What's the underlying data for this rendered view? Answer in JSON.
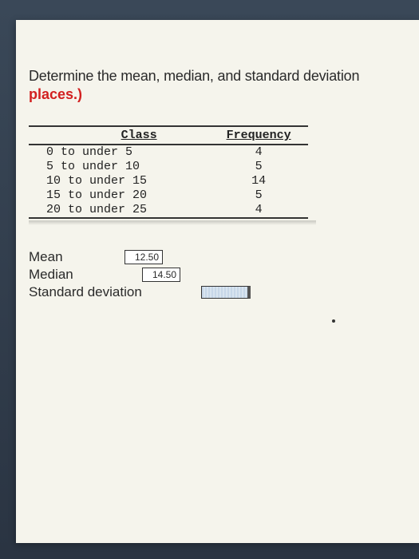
{
  "question_line": "Determine the mean, median, and standard deviation",
  "places_text": "places.)",
  "table": {
    "headers": [
      "Class",
      "Frequency"
    ],
    "rows": [
      {
        "class": "0 to under 5",
        "freq": "4"
      },
      {
        "class": "5 to under 10",
        "freq": "5"
      },
      {
        "class": "10 to under 15",
        "freq": "14"
      },
      {
        "class": "15 to under 20",
        "freq": "5"
      },
      {
        "class": "20 to under 25",
        "freq": "4"
      }
    ]
  },
  "results": {
    "mean_label": "Mean",
    "mean_value": "12.50",
    "median_label": "Median",
    "median_value": "14.50",
    "sd_label": "Standard deviation",
    "sd_value": ""
  }
}
